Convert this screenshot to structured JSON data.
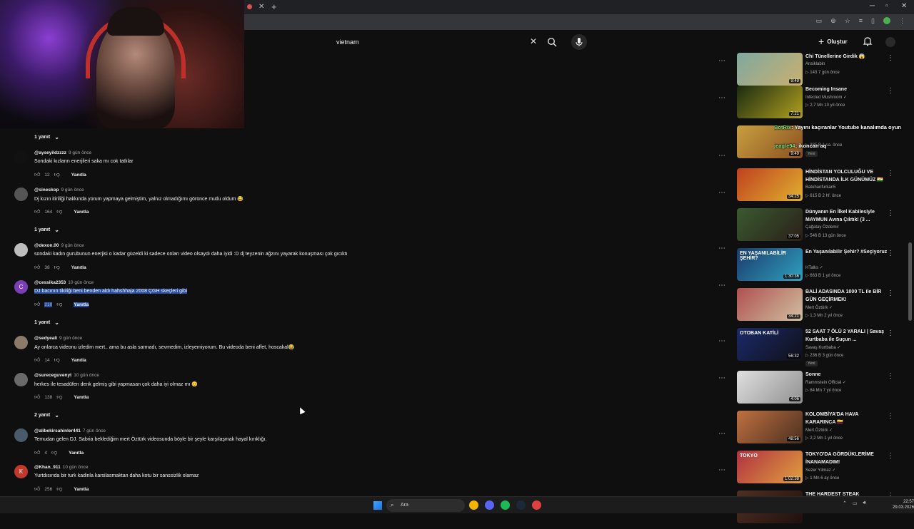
{
  "search": {
    "value": "vietnam"
  },
  "header": {
    "create_label": "Oluştur"
  },
  "comments": [
    {
      "replies_above": "1 yanıt"
    },
    {
      "handle": "@ayseyildzzzz",
      "time": "9 gün önce",
      "text": "Sondaki kızların enerjileri saka mı cok tatlılar",
      "likes": "12",
      "reply": "Yanıtla",
      "avatar_color": "#111111"
    },
    {
      "handle": "@sineskop",
      "time": "9 gün önce",
      "text": "Dj kızın itiriliği hakkında yorum yapmaya gelmiştim, yalnız olmadığımı görünce mutlu oldum 😂",
      "likes": "164",
      "reply": "Yanıtla",
      "avatar_color": "#555555",
      "replies": "1 yanıt"
    },
    {
      "handle": "@dexon.00",
      "time": "9 gün önce",
      "text": "sondaki kadın gurubunun enerjisi o kadar güzeldi ki sadece onları video olsaydı daha iyidi :D dj teyzenin ağzını yayarak konuşması çok gıcıktı",
      "likes": "38",
      "reply": "Yanıtla",
      "avatar_color": "#bdbdbd"
    },
    {
      "handle": "@cessika2353",
      "time": "10 gün önce",
      "text": "DJ bacının tikiliği beni benden aldı hahshhaja 2008 ÇGH skeçleri gibi",
      "likes": "210",
      "reply": "Yanıtla",
      "avatar_color": "#7b3fb5",
      "avatar_letter": "C",
      "replies": "1 yanıt"
    },
    {
      "handle": "@sedyeali",
      "time": "9 gün önce",
      "text": "Ay onlarca videonu izledim mert.. ama bu asla sarmadı, sevmedim, izleyemiyorum. Bu videoda beni affet, hoscakal😂",
      "likes": "14",
      "reply": "Yanıtla",
      "avatar_color": "#8a7a6a"
    },
    {
      "handle": "@sureceguvenyt",
      "time": "10 gün önce",
      "text": "herkes ile tesadüfen denk gelmiş gibi yapmasan çok daha iyi olmaz mı 😊",
      "likes": "138",
      "reply": "Yanıtla",
      "avatar_color": "#6a6a6a",
      "replies": "2 yanıt"
    },
    {
      "handle": "@alibekirsahinler441",
      "time": "7 gün önce",
      "text": "Temudan gelen DJ. Sabria beklediğim mert Öztürk videosunda böyle bir şeyle karşılaşmak hayal kırıklığı.",
      "likes": "4",
      "reply": "Yanıtla",
      "avatar_color": "#4a5a6a"
    },
    {
      "handle": "@Khan_911",
      "time": "10 gün önce",
      "text": "Yurtdısında bir turk kadinla karsilasmaktan daha kotu bir sanssizlik olamaz",
      "likes": "256",
      "reply": "Yanıtla",
      "avatar_color": "#c0392b",
      "avatar_letter": "K"
    }
  ],
  "sidebar": [
    {
      "title": "Chi Tünellerine Girdik 😱",
      "channel": "Ansiklabin",
      "stats": "▷ 143  7 gün önce",
      "duration": "9:49",
      "thumb_a": "#7fa8a0",
      "thumb_b": "#c9b070"
    },
    {
      "title": "Becoming Insane",
      "channel": "Infected Mushroom ✓",
      "stats": "▷ 2,7 Mn  10 yıl önce",
      "duration": "7:21",
      "thumb_a": "#1a2a10",
      "thumb_b": "#b0a020"
    },
    {
      "title": "",
      "channel": "",
      "stats": "▷ 385 B  1 sa. önce",
      "badge": "Yeni",
      "duration": "9:49",
      "thumb_a": "#c9a040",
      "thumb_b": "#8a5020"
    },
    {
      "title": "HİNDİSTAN YOLCULUĞU VE HİNDİSTANDA İLK GÜNÜMÜZ 🇮🇳",
      "channel": "Batuhanfurkan5",
      "stats": "▷ 615 B  2 hf. önce",
      "duration": "34:25",
      "thumb_a": "#c04020",
      "thumb_b": "#e0b030"
    },
    {
      "title": "Dünyanın En İlkel Kabilesiyle MAYMUN Avına Çıktık! (3 ...",
      "channel": "Çağatay Özdemir",
      "stats": "▷ 546 B  13 gün önce",
      "duration": "37:05",
      "thumb_a": "#3a5a30",
      "thumb_b": "#2a2018"
    },
    {
      "title": "En Yaşanılabilir Şehir? #Seçiyoruz",
      "channel": "HTalks ✓",
      "stats": "▷ 663 B  1 yıl önce",
      "duration": "1:30:36",
      "thumb_a": "#1a3a6a",
      "thumb_b": "#30a0c0",
      "thumb_text": "EN YAŞANILABİLİR ŞEHİR?"
    },
    {
      "title": "BALİ ADASINDA 1000 TL ile BİR GÜN GEÇİRMEK!",
      "channel": "Mert Öztürk ✓",
      "stats": "▷ 1,3 Mn  2 yıl önce",
      "duration": "34:21",
      "thumb_a": "#b05050",
      "thumb_b": "#d0c0a0"
    },
    {
      "title": "52 SAAT 7 ÖLÜ 2 YARALI | Savaş Kurtbaba ile Suçun ...",
      "channel": "Savaş Kurtbaba ✓",
      "stats": "▷ 236 B  3 gün önce",
      "badge": "Yeni",
      "duration": "56:32",
      "thumb_a": "#1a2a6a",
      "thumb_b": "#101018",
      "thumb_text": "OTOBAN KATİLİ"
    },
    {
      "title": "Sonne",
      "channel": "Rammstein Official ✓",
      "stats": "▷ 84 Mn  7 yıl önce",
      "duration": "4:06",
      "thumb_a": "#e0e0e0",
      "thumb_b": "#909090"
    },
    {
      "title": "KOLOMBİYA'DA HAVA KARARINCA 🇨🇴",
      "channel": "Mert Öztürk ✓",
      "stats": "▷ 2,2 Mn  1 yıl önce",
      "duration": "48:56",
      "thumb_a": "#c07040",
      "thumb_b": "#4a3020"
    },
    {
      "title": "TOKYO'DA GÖRDÜKLERİME İNANAMADIM!",
      "channel": "Sezer Yılmaz ✓",
      "stats": "▷ 1 Mn  6 ay önce",
      "duration": "1:02:38",
      "thumb_a": "#b03040",
      "thumb_b": "#e0a040",
      "thumb_text": "TOKYO"
    },
    {
      "title": "THE HARDEST STEAK",
      "channel": "",
      "stats": "",
      "duration": "",
      "thumb_a": "#503020",
      "thumb_b": "#201010"
    }
  ],
  "chat": [
    {
      "user": "BotRix",
      "msg": ": Yayını kaçıranlar Youtube kanalımda oyun"
    },
    {
      "user": "",
      "msg": ""
    },
    {
      "user": "jeagle94",
      "msg": ": ikoncan aq"
    }
  ],
  "taskbar": {
    "search_label": "Ara",
    "time": "22:57",
    "date": "29.03.2026"
  }
}
